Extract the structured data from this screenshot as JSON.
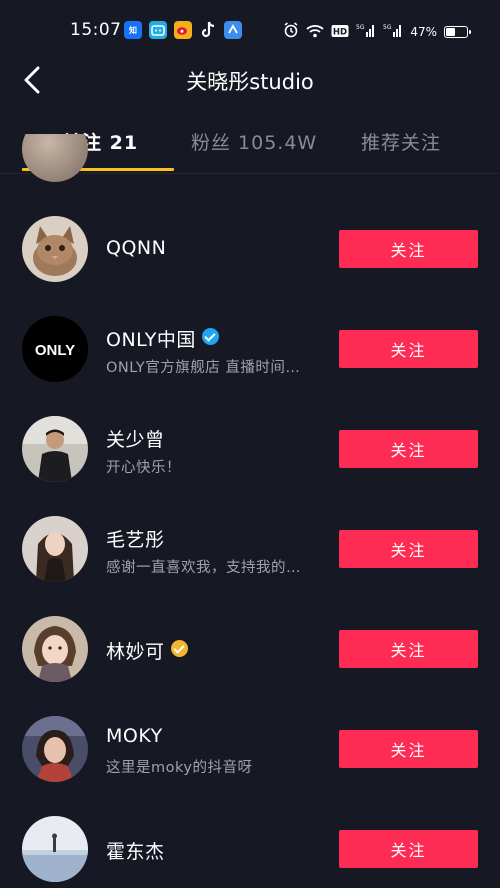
{
  "status_bar": {
    "time": "15:07",
    "app_icons": [
      "zhihu-icon",
      "bilibili-icon",
      "weibo-icon",
      "tiktok-icon",
      "browser-icon"
    ],
    "system_icons": [
      "alarm-icon",
      "wifi-icon",
      "hd-icon",
      "5g-signal-icon",
      "5g-signal-icon"
    ],
    "battery": "47%",
    "battery_level": 0.47
  },
  "header": {
    "title": "关晓彤studio",
    "back_icon": "back-arrow-icon"
  },
  "tabs": [
    {
      "label": "关注 21",
      "active": true
    },
    {
      "label": "粉丝 105.4W",
      "active": false
    },
    {
      "label": "推荐关注",
      "active": false
    }
  ],
  "users": [
    {
      "name": "QQNN",
      "description": "",
      "verified": "",
      "button": "关注"
    },
    {
      "name": "ONLY中国",
      "description": "ONLY官方旗舰店 直播时间…",
      "verified": "blue",
      "button": "关注"
    },
    {
      "name": "关少曾",
      "description": "开心快乐！",
      "verified": "",
      "button": "关注"
    },
    {
      "name": "毛艺彤",
      "description": "感谢一直喜欢我，支持我的…",
      "verified": "",
      "button": "关注"
    },
    {
      "name": "林妙可",
      "description": "",
      "verified": "gold",
      "button": "关注"
    },
    {
      "name": "MOKY",
      "description": "这里是moky的抖音呀",
      "verified": "",
      "button": "关注"
    },
    {
      "name": "霍东杰",
      "description": "",
      "verified": "",
      "button": "关注"
    }
  ],
  "logo_text": {
    "only": "ONLY"
  },
  "colors": {
    "background": "#161823",
    "follow_button": "#fe2c55",
    "tab_indicator": "#f8c21b",
    "verified_blue": "#20a5f0",
    "verified_gold": "#f4b531"
  }
}
